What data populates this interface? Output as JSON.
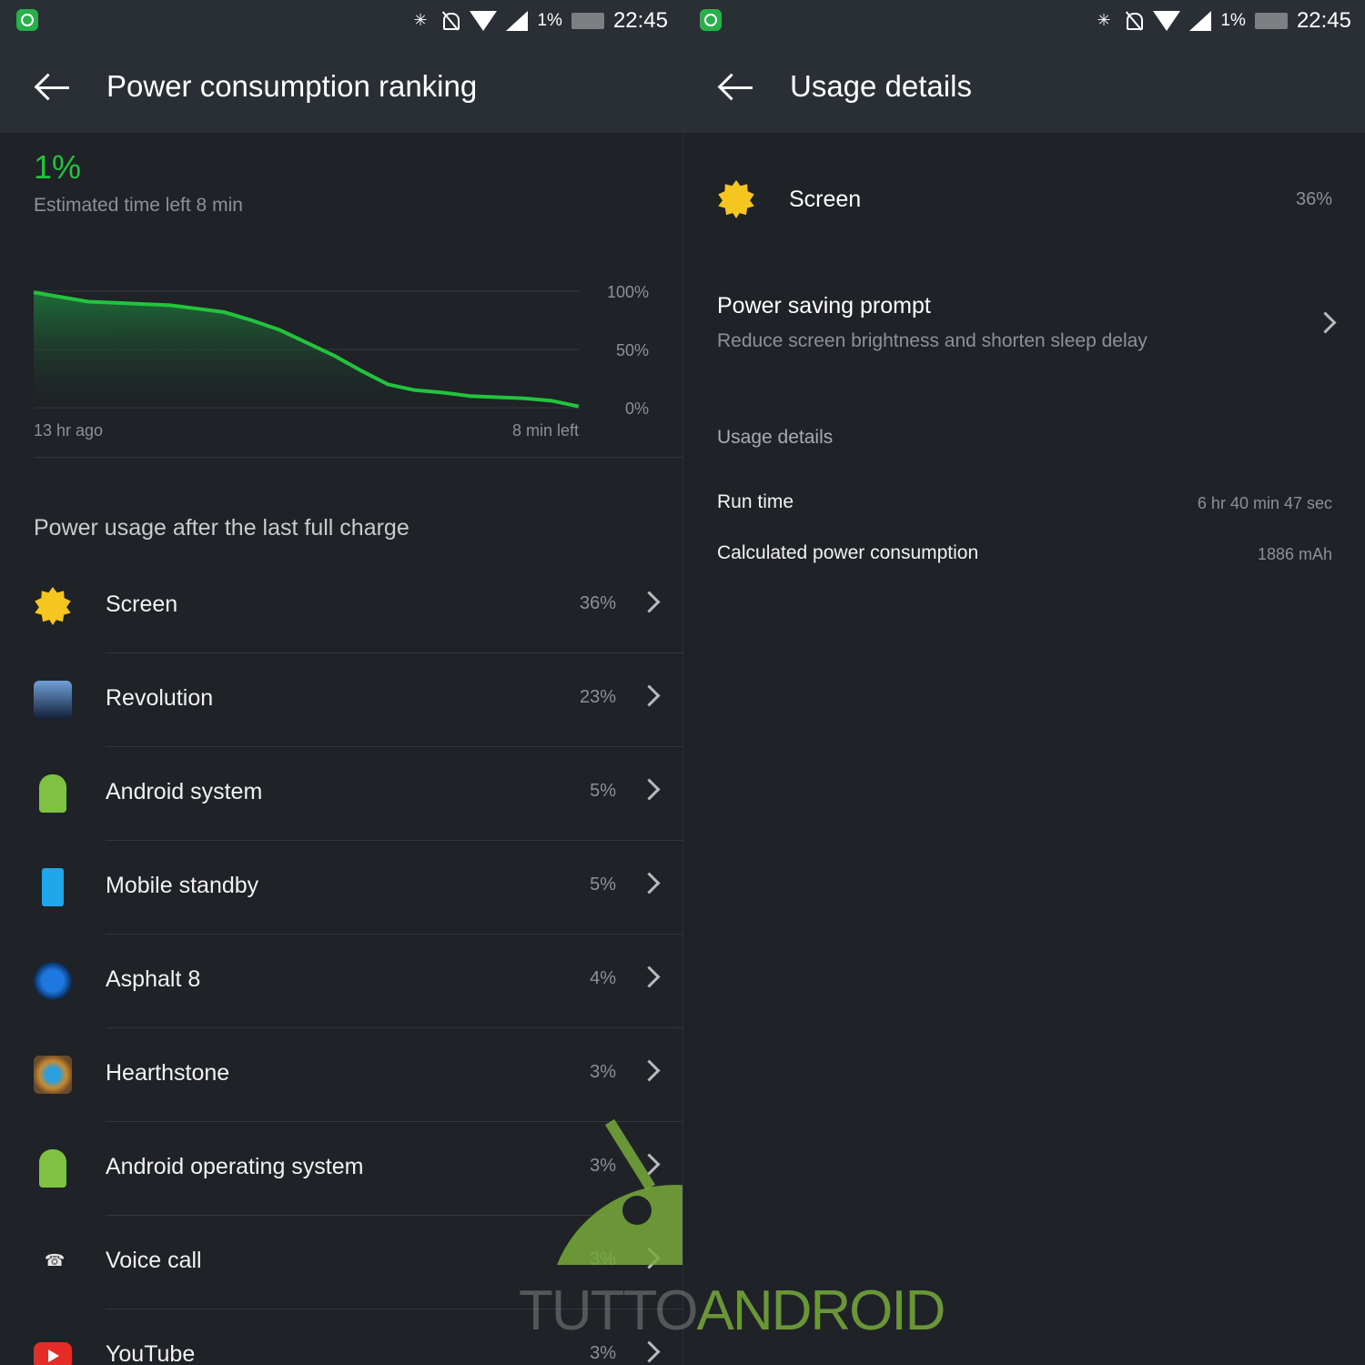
{
  "status": {
    "battery_pct": "1%",
    "time": "22:45"
  },
  "left": {
    "title": "Power consumption ranking",
    "battery_level": "1%",
    "estimated": "Estimated time left 8 min",
    "section_heading": "Power usage after the last full charge",
    "items": [
      {
        "label": "Screen",
        "pct": "36%",
        "icon": "sun-icon"
      },
      {
        "label": "Revolution",
        "pct": "23%",
        "icon": "game-icon"
      },
      {
        "label": "Android system",
        "pct": "5%",
        "icon": "android-icon"
      },
      {
        "label": "Mobile standby",
        "pct": "5%",
        "icon": "phone-icon"
      },
      {
        "label": "Asphalt 8",
        "pct": "4%",
        "icon": "car-icon"
      },
      {
        "label": "Hearthstone",
        "pct": "3%",
        "icon": "hearthstone-icon"
      },
      {
        "label": "Android operating system",
        "pct": "3%",
        "icon": "android-icon"
      },
      {
        "label": "Voice call",
        "pct": "3%",
        "icon": "phone-call-icon"
      },
      {
        "label": "YouTube",
        "pct": "3%",
        "icon": "youtube-icon"
      }
    ]
  },
  "chart_data": {
    "type": "area",
    "x_start_label": "13 hr ago",
    "x_end_label": "8 min left",
    "y_ticks": [
      "100%",
      "50%",
      "0%"
    ],
    "ylim": [
      0,
      100
    ],
    "grid": true,
    "color": "#22c43d",
    "x": [
      0,
      0.05,
      0.1,
      0.15,
      0.2,
      0.25,
      0.3,
      0.35,
      0.4,
      0.45,
      0.5,
      0.55,
      0.6,
      0.65,
      0.7,
      0.75,
      0.8,
      0.85,
      0.9,
      0.95,
      1.0
    ],
    "values": [
      99,
      95,
      91,
      90,
      89,
      88,
      85,
      82,
      75,
      67,
      56,
      45,
      32,
      20,
      15,
      13,
      10,
      9,
      8,
      6,
      1
    ]
  },
  "right": {
    "title": "Usage details",
    "item_label": "Screen",
    "item_pct": "36%",
    "prompt_title": "Power saving prompt",
    "prompt_sub": "Reduce screen brightness and shorten sleep delay",
    "usage_heading": "Usage details",
    "run_time_label": "Run time",
    "run_time_value": "6 hr 40 min 47 sec",
    "consumption_label": "Calculated power consumption",
    "consumption_value": "1886 mAh"
  },
  "watermark": {
    "part1": "TUTTO",
    "part2": "ANDROID"
  }
}
